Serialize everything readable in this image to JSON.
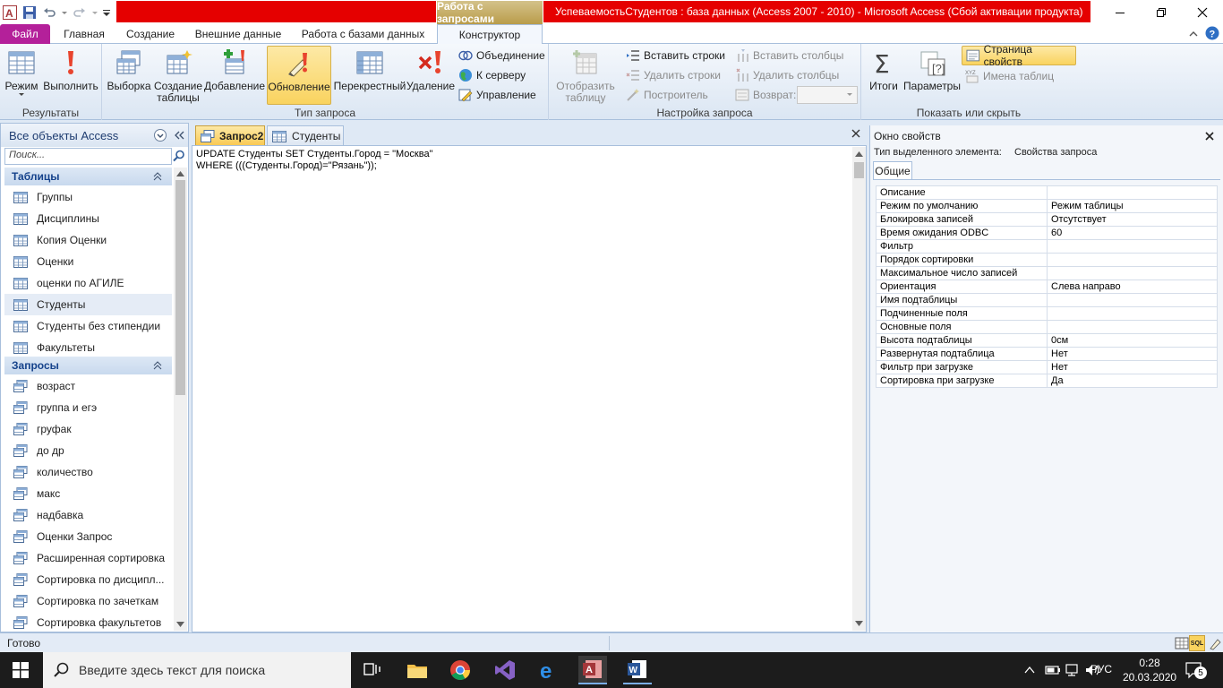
{
  "window": {
    "context_tab": "Работа с запросами",
    "title": "УспеваемостьСтудентов : база данных (Access 2007 - 2010)  -  Microsoft Access (Сбой активации продукта)"
  },
  "tabs": [
    "Файл",
    "Главная",
    "Создание",
    "Внешние данные",
    "Работа с базами данных",
    "Конструктор"
  ],
  "ribbon": {
    "results": {
      "label": "Результаты",
      "mode": "Режим",
      "run": "Выполнить"
    },
    "query_type": {
      "label": "Тип запроса",
      "select": "Выборка",
      "make_table_1": "Создание",
      "make_table_2": "таблицы",
      "append": "Добавление",
      "update": "Обновление",
      "crosstab": "Перекрестный",
      "delete": "Удаление",
      "union": "Объединение",
      "passthrough": "К серверу",
      "ddl": "Управление"
    },
    "setup": {
      "label": "Настройка запроса",
      "show_table_1": "Отобразить",
      "show_table_2": "таблицу",
      "insert_rows": "Вставить строки",
      "delete_rows": "Удалить строки",
      "builder": "Построитель",
      "insert_cols": "Вставить столбцы",
      "delete_cols": "Удалить столбцы",
      "return": "Возврат:"
    },
    "show_hide": {
      "label": "Показать или скрыть",
      "totals": "Итоги",
      "params": "Параметры",
      "property_sheet": "Страница свойств",
      "table_names": "Имена таблиц"
    }
  },
  "nav": {
    "title": "Все объекты Access",
    "search_placeholder": "Поиск...",
    "tables_header": "Таблицы",
    "tables": [
      "Группы",
      "Дисциплины",
      "Копия Оценки",
      "Оценки",
      "оценки по АГИЛЕ",
      "Студенты",
      "Студенты без стипендии",
      "Факультеты"
    ],
    "queries_header": "Запросы",
    "queries": [
      "возраст",
      "группа и егэ",
      "груфак",
      "до др",
      "количество",
      "макс",
      "надбавка",
      "Оценки Запрос",
      "Расширенная сортировка",
      "Сортировка по дисципл...",
      "Сортировка по зачеткам",
      "Сортировка факультетов"
    ]
  },
  "doc_tabs": [
    "Запрос2",
    "Студенты"
  ],
  "sql": "UPDATE Студенты SET Студенты.Город = \"Москва\"\nWHERE (((Студенты.Город)=\"Рязань\"));",
  "props": {
    "title": "Окно свойств",
    "selection_label": "Тип выделенного элемента:",
    "selection_value": "Свойства запроса",
    "tab": "Общие",
    "rows": [
      [
        "Описание",
        ""
      ],
      [
        "Режим по умолчанию",
        "Режим таблицы"
      ],
      [
        "Блокировка записей",
        "Отсутствует"
      ],
      [
        "Время ожидания ODBC",
        "60"
      ],
      [
        "Фильтр",
        ""
      ],
      [
        "Порядок сортировки",
        ""
      ],
      [
        "Максимальное число записей",
        ""
      ],
      [
        "Ориентация",
        "Слева направо"
      ],
      [
        "Имя подтаблицы",
        ""
      ],
      [
        "Подчиненные поля",
        ""
      ],
      [
        "Основные поля",
        ""
      ],
      [
        "Высота подтаблицы",
        "0см"
      ],
      [
        "Развернутая подтаблица",
        "Нет"
      ],
      [
        "Фильтр при загрузке",
        "Нет"
      ],
      [
        "Сортировка при загрузке",
        "Да"
      ]
    ]
  },
  "status": {
    "text": "Готово",
    "view_sql": "SQL"
  },
  "taskbar": {
    "search_placeholder": "Введите здесь текст для поиска",
    "lang": "РУС",
    "time": "0:28",
    "date": "20.03.2020",
    "notifications": "5"
  }
}
